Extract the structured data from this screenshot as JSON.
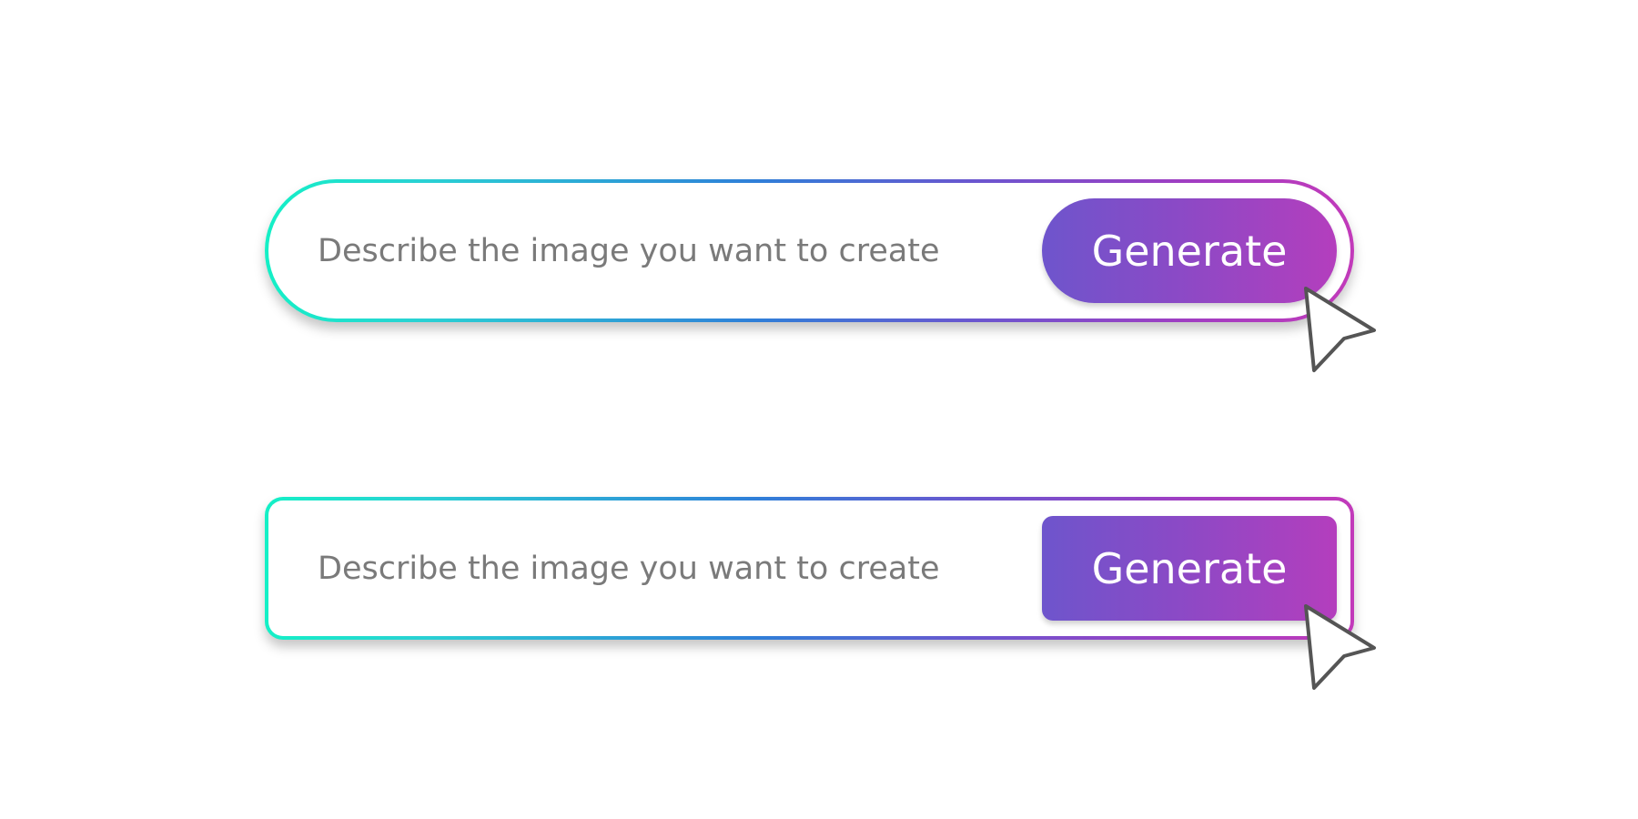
{
  "variants": [
    {
      "style": "pill",
      "input_placeholder": "Describe the image you want to create",
      "button_label": "Generate"
    },
    {
      "style": "rounded-rectangle",
      "input_placeholder": "Describe the image you want to create",
      "button_label": "Generate"
    }
  ],
  "colors": {
    "border_gradient_start": "#14f0c6",
    "border_gradient_mid": "#2f7fd8",
    "border_gradient_end": "#c23aba",
    "button_gradient_start": "#6e55cc",
    "button_gradient_end": "#b43ebd",
    "placeholder_text": "#7a7a7a",
    "button_text": "#ffffff"
  },
  "icons": {
    "cursor": "mouse-pointer-icon"
  }
}
